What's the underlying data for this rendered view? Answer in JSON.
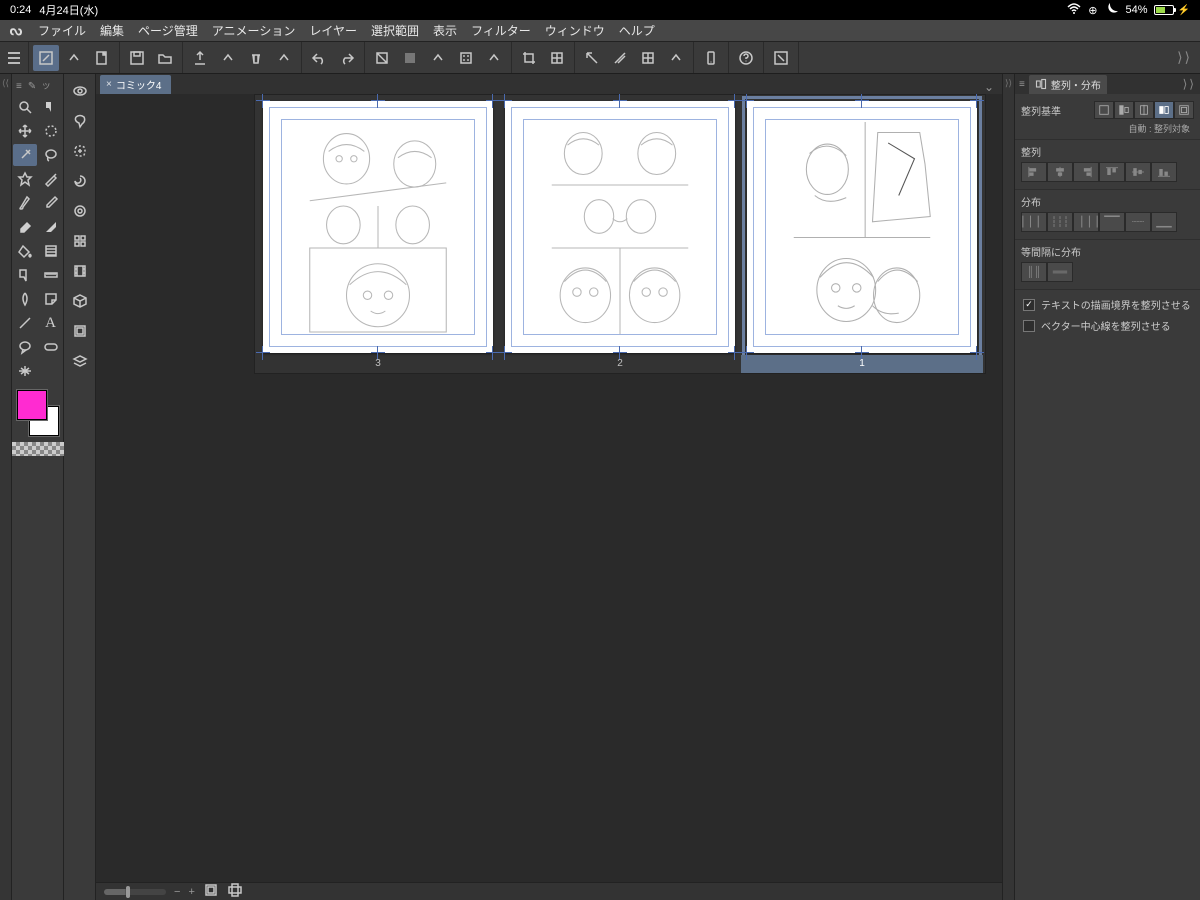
{
  "status": {
    "time": "0:24",
    "date": "4月24日(水)",
    "battery": "54%",
    "charging": true
  },
  "menu": [
    "ファイル",
    "編集",
    "ページ管理",
    "アニメーション",
    "レイヤー",
    "選択範囲",
    "表示",
    "フィルター",
    "ウィンドウ",
    "ヘルプ"
  ],
  "doc": {
    "tab": "コミック4"
  },
  "pages": [
    {
      "num": "3",
      "selected": false
    },
    {
      "num": "2",
      "selected": false
    },
    {
      "num": "1",
      "selected": true
    }
  ],
  "colors": {
    "fg": "#ff2bd1",
    "bg": "#ffffff"
  },
  "panel": {
    "title": "整列・分布",
    "basis": "整列基準",
    "auto": "自動 : 整列対象",
    "align": "整列",
    "distribute": "分布",
    "equal": "等間隔に分布",
    "opt1": "テキストの描画境界を整列させる",
    "opt2": "ベクター中心線を整列させる"
  }
}
